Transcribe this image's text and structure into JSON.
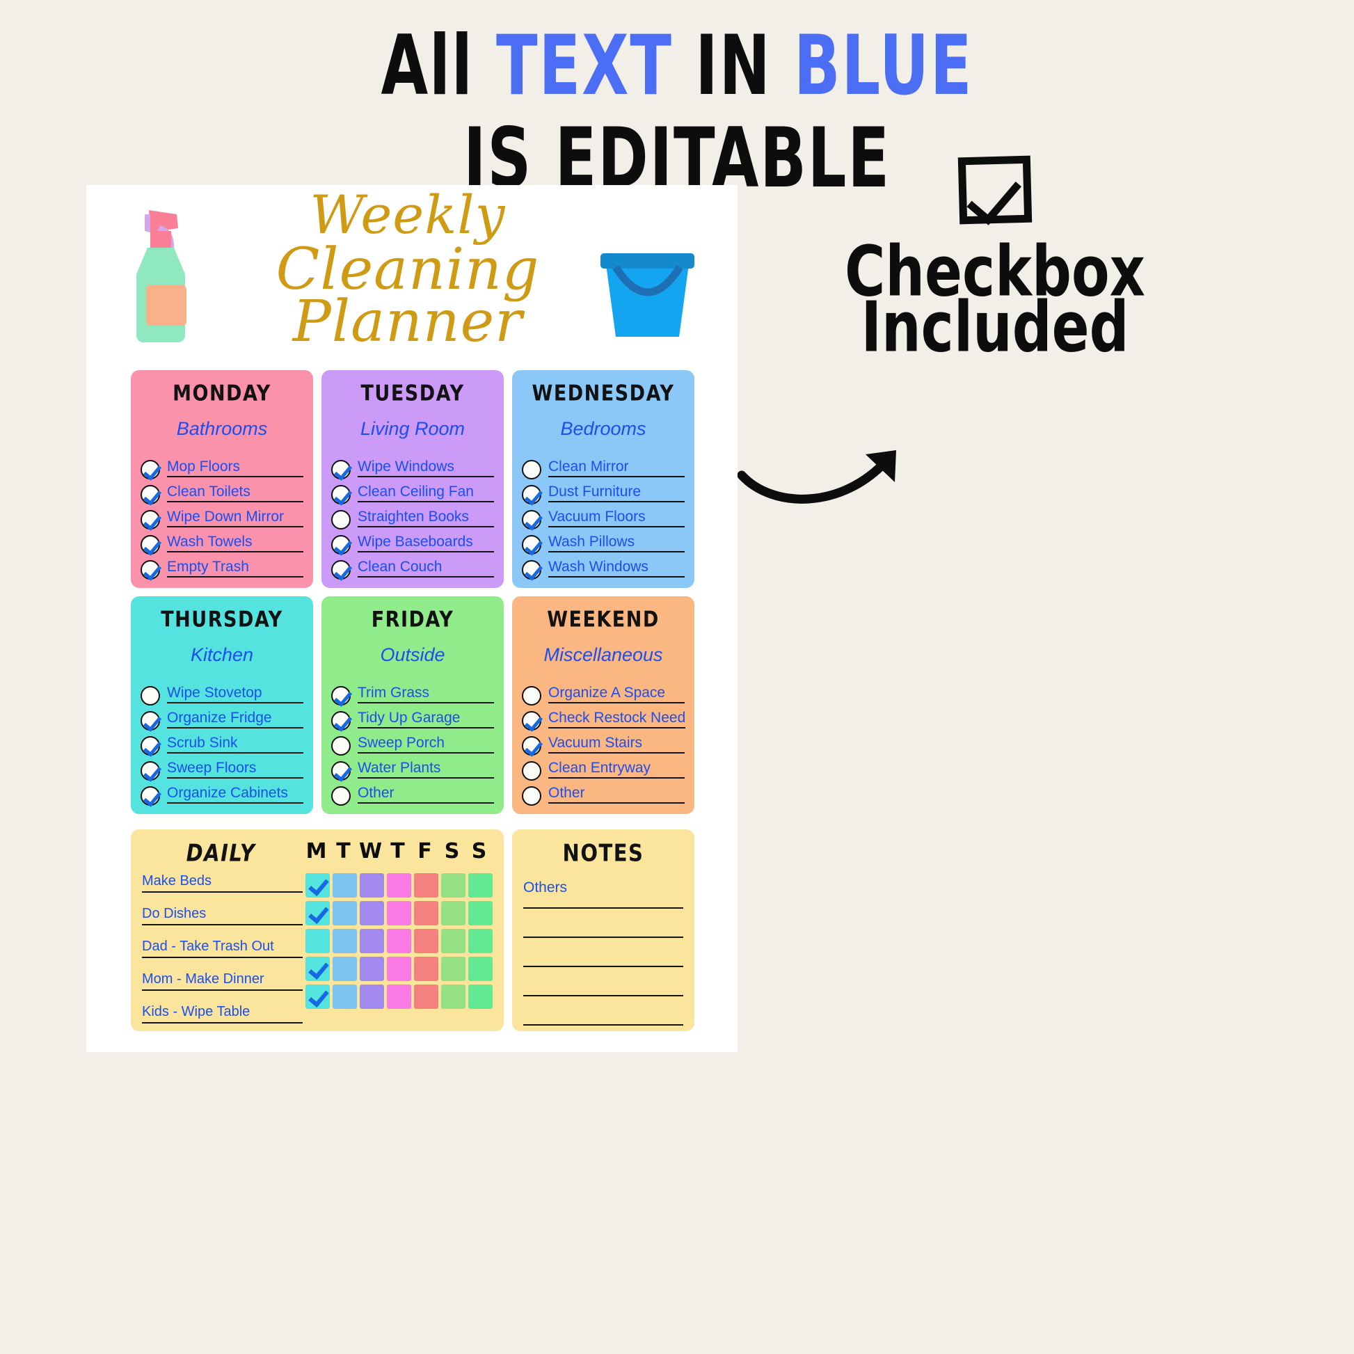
{
  "banner": {
    "line1_a": "All ",
    "line1_b": "TEXT",
    "line1_c": " IN ",
    "line1_d": "BLUE",
    "line2": "IS EDITABLE",
    "blue_color": "#4b6ef5",
    "black_color": "#0d0d0d"
  },
  "annotation": {
    "checkbox_icon": "checked-checkbox-icon",
    "line1": "Checkbox",
    "line2": "Included",
    "arrow_icon": "curved-arrow-icon"
  },
  "planner": {
    "title_line1": "Weekly",
    "title_line2": "Cleaning Planner",
    "title_color": "#cf9a14",
    "spray_icon": "spray-bottle-icon",
    "bucket_icon": "bucket-icon",
    "editable_text_color": "#1b4ef0",
    "cards": [
      {
        "day": "MONDAY",
        "room": "Bathrooms",
        "color": "#fb92ab",
        "items": [
          {
            "label": "Mop Floors",
            "checked": true
          },
          {
            "label": "Clean Toilets",
            "checked": true
          },
          {
            "label": "Wipe Down Mirror",
            "checked": true
          },
          {
            "label": "Wash Towels",
            "checked": true
          },
          {
            "label": "Empty Trash",
            "checked": true
          }
        ]
      },
      {
        "day": "TUESDAY",
        "room": "Living Room",
        "color": "#cb9bf7",
        "items": [
          {
            "label": "Wipe Windows",
            "checked": true
          },
          {
            "label": "Clean Ceiling Fan",
            "checked": true
          },
          {
            "label": "Straighten Books",
            "checked": false
          },
          {
            "label": "Wipe Baseboards",
            "checked": true
          },
          {
            "label": "Clean Couch",
            "checked": true
          }
        ]
      },
      {
        "day": "WEDNESDAY",
        "room": "Bedrooms",
        "color": "#8cc8f7",
        "items": [
          {
            "label": "Clean Mirror",
            "checked": false
          },
          {
            "label": "Dust Furniture",
            "checked": true
          },
          {
            "label": "Vacuum Floors",
            "checked": true
          },
          {
            "label": "Wash Pillows",
            "checked": true
          },
          {
            "label": "Wash Windows",
            "checked": true
          }
        ]
      },
      {
        "day": "THURSDAY",
        "room": "Kitchen",
        "color": "#55e3df",
        "items": [
          {
            "label": "Wipe Stovetop",
            "checked": false
          },
          {
            "label": "Organize Fridge",
            "checked": true
          },
          {
            "label": "Scrub Sink",
            "checked": true
          },
          {
            "label": "Sweep Floors",
            "checked": true
          },
          {
            "label": "Organize Cabinets",
            "checked": true
          }
        ]
      },
      {
        "day": "FRIDAY",
        "room": "Outside",
        "color": "#90ec8a",
        "items": [
          {
            "label": "Trim Grass",
            "checked": true
          },
          {
            "label": "Tidy Up Garage",
            "checked": true
          },
          {
            "label": "Sweep Porch",
            "checked": false
          },
          {
            "label": "Water Plants",
            "checked": true
          },
          {
            "label": "Other",
            "checked": false
          }
        ]
      },
      {
        "day": "WEEKEND",
        "room": "Miscellaneous",
        "color": "#fbb782",
        "items": [
          {
            "label": "Organize A Space",
            "checked": false
          },
          {
            "label": "Check Restock Need",
            "checked": true
          },
          {
            "label": "Vacuum Stairs",
            "checked": true
          },
          {
            "label": "Clean Entryway",
            "checked": false
          },
          {
            "label": "Other",
            "checked": false
          }
        ]
      }
    ],
    "daily": {
      "heading": "DAILY",
      "panel_color": "#fbe59c",
      "day_headers": [
        "M",
        "T",
        "W",
        "T",
        "F",
        "S",
        "S"
      ],
      "column_colors": [
        "#55e3df",
        "#7cc4f0",
        "#a189f0",
        "#fb7ae6",
        "#f58080",
        "#95e084",
        "#63e894"
      ],
      "rows": [
        {
          "label": "Make Beds",
          "checks": [
            true,
            false,
            false,
            false,
            false,
            false,
            false
          ]
        },
        {
          "label": "Do Dishes",
          "checks": [
            true,
            false,
            false,
            false,
            false,
            false,
            false
          ]
        },
        {
          "label": "Dad - Take Trash Out",
          "checks": [
            false,
            false,
            false,
            false,
            false,
            false,
            false
          ]
        },
        {
          "label": "Mom - Make Dinner",
          "checks": [
            true,
            false,
            false,
            false,
            false,
            false,
            false
          ]
        },
        {
          "label": "Kids - Wipe Table",
          "checks": [
            true,
            false,
            false,
            false,
            false,
            false,
            false
          ]
        }
      ]
    },
    "notes": {
      "heading": "NOTES",
      "first_line_text": "Others",
      "blank_lines": 4
    }
  }
}
